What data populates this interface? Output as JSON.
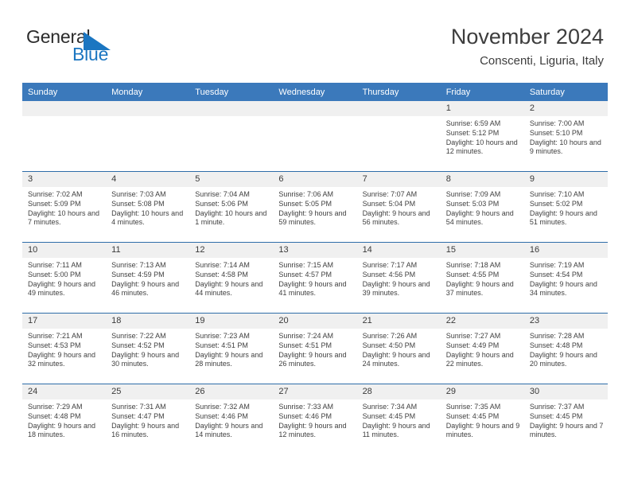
{
  "logo": {
    "word1": "General",
    "word2": "Blue",
    "mark": "triangle-pennant",
    "color_primary": "#1b76c1",
    "color_text": "#2b2b2b"
  },
  "header": {
    "title": "November 2024",
    "subtitle": "Conscenti, Liguria, Italy"
  },
  "theme": {
    "header_bar": "#3b79bb",
    "row_rule": "#2e6da9",
    "daynum_band": "#f0f0f0",
    "page_bg": "#ffffff"
  },
  "weekday_headers": [
    "Sunday",
    "Monday",
    "Tuesday",
    "Wednesday",
    "Thursday",
    "Friday",
    "Saturday"
  ],
  "labels": {
    "sunrise_prefix": "Sunrise: ",
    "sunset_prefix": "Sunset: ",
    "daylight_prefix": "Daylight: "
  },
  "weeks": [
    [
      {
        "empty": true
      },
      {
        "empty": true
      },
      {
        "empty": true
      },
      {
        "empty": true
      },
      {
        "empty": true
      },
      {
        "day": "1",
        "sunrise": "Sunrise: 6:59 AM",
        "sunset": "Sunset: 5:12 PM",
        "daylight": "Daylight: 10 hours and 12 minutes."
      },
      {
        "day": "2",
        "sunrise": "Sunrise: 7:00 AM",
        "sunset": "Sunset: 5:10 PM",
        "daylight": "Daylight: 10 hours and 9 minutes."
      }
    ],
    [
      {
        "day": "3",
        "sunrise": "Sunrise: 7:02 AM",
        "sunset": "Sunset: 5:09 PM",
        "daylight": "Daylight: 10 hours and 7 minutes."
      },
      {
        "day": "4",
        "sunrise": "Sunrise: 7:03 AM",
        "sunset": "Sunset: 5:08 PM",
        "daylight": "Daylight: 10 hours and 4 minutes."
      },
      {
        "day": "5",
        "sunrise": "Sunrise: 7:04 AM",
        "sunset": "Sunset: 5:06 PM",
        "daylight": "Daylight: 10 hours and 1 minute."
      },
      {
        "day": "6",
        "sunrise": "Sunrise: 7:06 AM",
        "sunset": "Sunset: 5:05 PM",
        "daylight": "Daylight: 9 hours and 59 minutes."
      },
      {
        "day": "7",
        "sunrise": "Sunrise: 7:07 AM",
        "sunset": "Sunset: 5:04 PM",
        "daylight": "Daylight: 9 hours and 56 minutes."
      },
      {
        "day": "8",
        "sunrise": "Sunrise: 7:09 AM",
        "sunset": "Sunset: 5:03 PM",
        "daylight": "Daylight: 9 hours and 54 minutes."
      },
      {
        "day": "9",
        "sunrise": "Sunrise: 7:10 AM",
        "sunset": "Sunset: 5:02 PM",
        "daylight": "Daylight: 9 hours and 51 minutes."
      }
    ],
    [
      {
        "day": "10",
        "sunrise": "Sunrise: 7:11 AM",
        "sunset": "Sunset: 5:00 PM",
        "daylight": "Daylight: 9 hours and 49 minutes."
      },
      {
        "day": "11",
        "sunrise": "Sunrise: 7:13 AM",
        "sunset": "Sunset: 4:59 PM",
        "daylight": "Daylight: 9 hours and 46 minutes."
      },
      {
        "day": "12",
        "sunrise": "Sunrise: 7:14 AM",
        "sunset": "Sunset: 4:58 PM",
        "daylight": "Daylight: 9 hours and 44 minutes."
      },
      {
        "day": "13",
        "sunrise": "Sunrise: 7:15 AM",
        "sunset": "Sunset: 4:57 PM",
        "daylight": "Daylight: 9 hours and 41 minutes."
      },
      {
        "day": "14",
        "sunrise": "Sunrise: 7:17 AM",
        "sunset": "Sunset: 4:56 PM",
        "daylight": "Daylight: 9 hours and 39 minutes."
      },
      {
        "day": "15",
        "sunrise": "Sunrise: 7:18 AM",
        "sunset": "Sunset: 4:55 PM",
        "daylight": "Daylight: 9 hours and 37 minutes."
      },
      {
        "day": "16",
        "sunrise": "Sunrise: 7:19 AM",
        "sunset": "Sunset: 4:54 PM",
        "daylight": "Daylight: 9 hours and 34 minutes."
      }
    ],
    [
      {
        "day": "17",
        "sunrise": "Sunrise: 7:21 AM",
        "sunset": "Sunset: 4:53 PM",
        "daylight": "Daylight: 9 hours and 32 minutes."
      },
      {
        "day": "18",
        "sunrise": "Sunrise: 7:22 AM",
        "sunset": "Sunset: 4:52 PM",
        "daylight": "Daylight: 9 hours and 30 minutes."
      },
      {
        "day": "19",
        "sunrise": "Sunrise: 7:23 AM",
        "sunset": "Sunset: 4:51 PM",
        "daylight": "Daylight: 9 hours and 28 minutes."
      },
      {
        "day": "20",
        "sunrise": "Sunrise: 7:24 AM",
        "sunset": "Sunset: 4:51 PM",
        "daylight": "Daylight: 9 hours and 26 minutes."
      },
      {
        "day": "21",
        "sunrise": "Sunrise: 7:26 AM",
        "sunset": "Sunset: 4:50 PM",
        "daylight": "Daylight: 9 hours and 24 minutes."
      },
      {
        "day": "22",
        "sunrise": "Sunrise: 7:27 AM",
        "sunset": "Sunset: 4:49 PM",
        "daylight": "Daylight: 9 hours and 22 minutes."
      },
      {
        "day": "23",
        "sunrise": "Sunrise: 7:28 AM",
        "sunset": "Sunset: 4:48 PM",
        "daylight": "Daylight: 9 hours and 20 minutes."
      }
    ],
    [
      {
        "day": "24",
        "sunrise": "Sunrise: 7:29 AM",
        "sunset": "Sunset: 4:48 PM",
        "daylight": "Daylight: 9 hours and 18 minutes."
      },
      {
        "day": "25",
        "sunrise": "Sunrise: 7:31 AM",
        "sunset": "Sunset: 4:47 PM",
        "daylight": "Daylight: 9 hours and 16 minutes."
      },
      {
        "day": "26",
        "sunrise": "Sunrise: 7:32 AM",
        "sunset": "Sunset: 4:46 PM",
        "daylight": "Daylight: 9 hours and 14 minutes."
      },
      {
        "day": "27",
        "sunrise": "Sunrise: 7:33 AM",
        "sunset": "Sunset: 4:46 PM",
        "daylight": "Daylight: 9 hours and 12 minutes."
      },
      {
        "day": "28",
        "sunrise": "Sunrise: 7:34 AM",
        "sunset": "Sunset: 4:45 PM",
        "daylight": "Daylight: 9 hours and 11 minutes."
      },
      {
        "day": "29",
        "sunrise": "Sunrise: 7:35 AM",
        "sunset": "Sunset: 4:45 PM",
        "daylight": "Daylight: 9 hours and 9 minutes."
      },
      {
        "day": "30",
        "sunrise": "Sunrise: 7:37 AM",
        "sunset": "Sunset: 4:45 PM",
        "daylight": "Daylight: 9 hours and 7 minutes."
      }
    ]
  ]
}
